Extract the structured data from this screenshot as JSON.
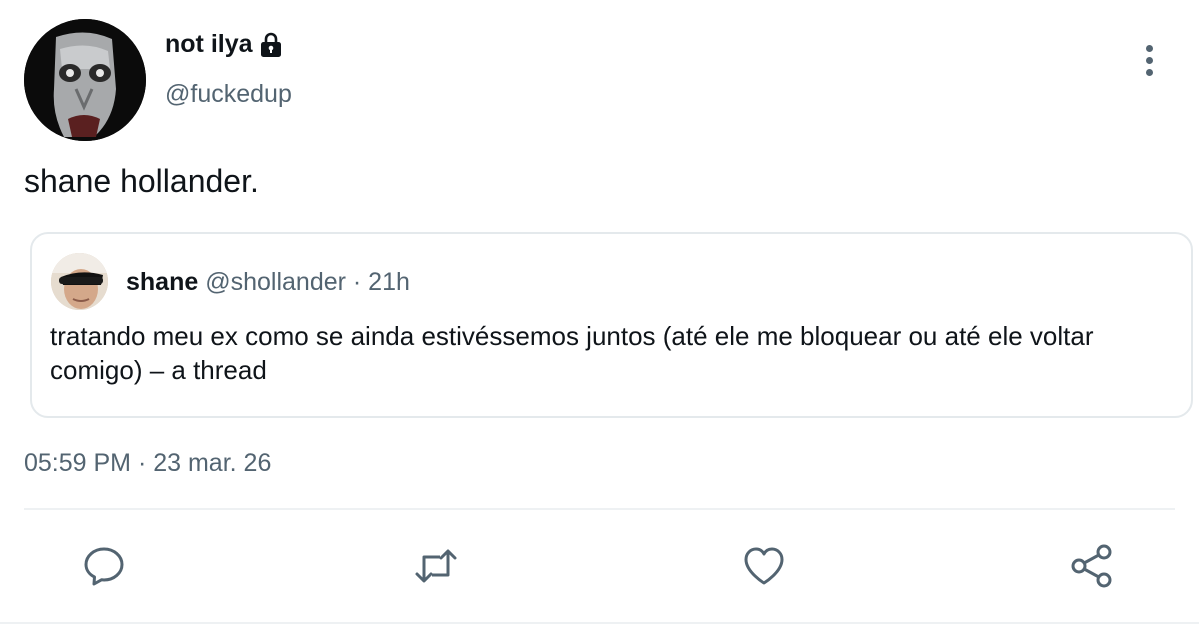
{
  "author": {
    "display_name": "not ilya",
    "handle": "@fuckedup",
    "protected_icon": "lock-icon"
  },
  "tweet": {
    "text": "shane hollander.",
    "timestamp": "05:59 PM · 23 mar. 26"
  },
  "quote": {
    "display_name": "shane",
    "meta": "@shollander · 21h",
    "text": "tratando meu ex como se ainda estivéssemos juntos (até ele me bloquear ou até ele voltar comigo) – a thread"
  },
  "actions": {
    "reply_icon": "reply-icon",
    "retweet_icon": "retweet-icon",
    "like_icon": "like-icon",
    "share_icon": "share-icon",
    "more_icon": "more-options-icon"
  },
  "colors": {
    "text_primary": "#0f1419",
    "text_secondary": "#536471",
    "border": "#e4e9ec",
    "action_icon": "#536471"
  }
}
